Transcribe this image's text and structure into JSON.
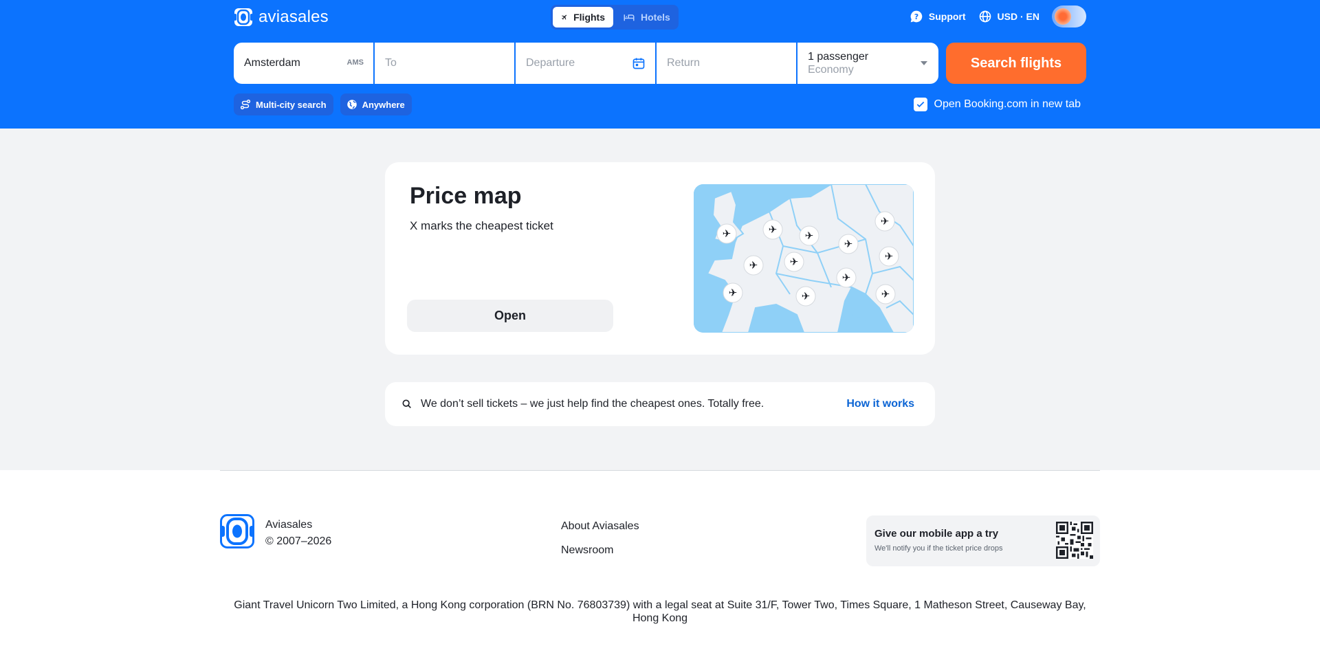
{
  "header": {
    "logo_text": "aviasales",
    "tabs": [
      {
        "label": "Flights",
        "active": true,
        "icon": "plane-icon"
      },
      {
        "label": "Hotels",
        "active": false,
        "icon": "bed-icon"
      }
    ],
    "support_label": "Support",
    "locale_label": "USD · EN"
  },
  "search": {
    "from_value": "Amsterdam",
    "from_iata": "AMS",
    "to_placeholder": "To",
    "departure_placeholder": "Departure",
    "return_placeholder": "Return",
    "passengers": "1 passenger",
    "cabin_class": "Economy",
    "submit_label": "Search flights",
    "multi_city_label": "Multi-city search",
    "anywhere_label": "Anywhere",
    "booking_option_label": "Open Booking.com in new tab",
    "booking_option_checked": true
  },
  "price_map": {
    "title": "Price map",
    "subtitle": "X marks the cheapest ticket",
    "open_label": "Open"
  },
  "info": {
    "text": "We don’t sell tickets – we just help find the cheapest ones. Totally free.",
    "link_label": "How it works"
  },
  "footer": {
    "brand": "Aviasales",
    "copyright": "© 2007–2026",
    "links": [
      "About Aviasales",
      "Newsroom"
    ],
    "app_title": "Give our mobile app a try",
    "app_subtitle": "We'll notify you if the ticket price drops",
    "legal": "Giant Travel Unicorn Two Limited, a Hong Kong corporation (BRN No. 76803739) with a legal seat at Suite 31/F, Tower Two, Times Square, 1 Matheson Street, Causeway Bay, Hong Kong"
  },
  "colors": {
    "brand_blue": "#0c73fe",
    "accent_orange": "#ff6d2d",
    "link_blue": "#0b64d4"
  }
}
